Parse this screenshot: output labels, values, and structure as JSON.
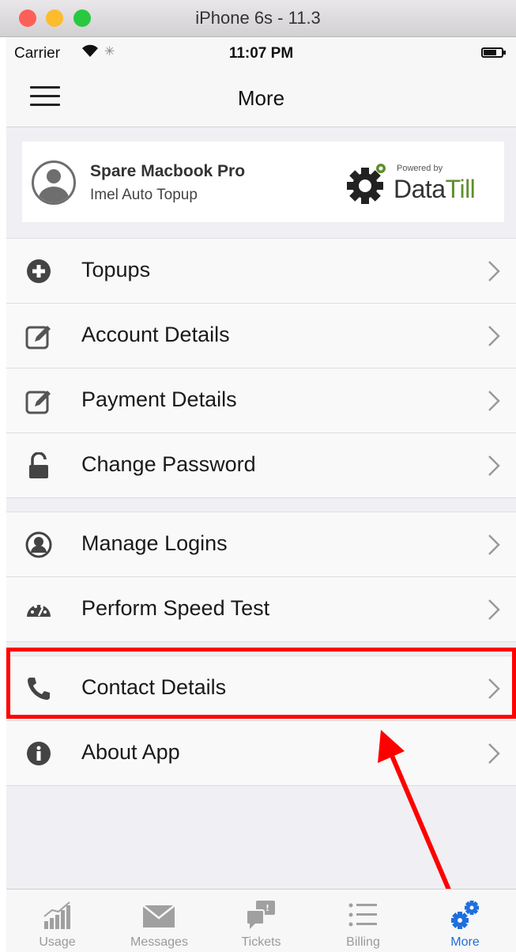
{
  "window": {
    "title": "iPhone 6s - 11.3"
  },
  "status_bar": {
    "carrier": "Carrier",
    "time": "11:07 PM"
  },
  "nav": {
    "title": "More"
  },
  "profile": {
    "name": "Spare Macbook Pro",
    "subtitle": "Imel Auto Topup"
  },
  "brand": {
    "powered_by": "Powered by",
    "name_part1": "Data",
    "name_part2": "Till",
    "accent_color": "#5d8f2a"
  },
  "menu_groups": [
    [
      {
        "label": "Topups",
        "icon": "plus-circle-icon"
      },
      {
        "label": "Account Details",
        "icon": "edit-icon"
      },
      {
        "label": "Payment Details",
        "icon": "edit-icon"
      },
      {
        "label": "Change Password",
        "icon": "unlock-icon"
      }
    ],
    [
      {
        "label": "Manage Logins",
        "icon": "user-circle-icon"
      },
      {
        "label": "Perform Speed Test",
        "icon": "speedometer-icon"
      }
    ],
    [
      {
        "label": "Contact Details",
        "icon": "phone-icon"
      },
      {
        "label": "About App",
        "icon": "info-circle-icon"
      }
    ]
  ],
  "annotation": {
    "highlight_color": "#ff0000",
    "highlighted_item": "Contact Details"
  },
  "tabs": [
    {
      "label": "Usage",
      "icon": "bar-chart-icon"
    },
    {
      "label": "Messages",
      "icon": "envelope-icon"
    },
    {
      "label": "Tickets",
      "icon": "chat-bubbles-icon"
    },
    {
      "label": "Billing",
      "icon": "list-icon"
    },
    {
      "label": "More",
      "icon": "gears-icon",
      "active": true
    }
  ],
  "colors": {
    "active_tab": "#1e6fdc",
    "inactive_tab": "#9a9a9a"
  }
}
